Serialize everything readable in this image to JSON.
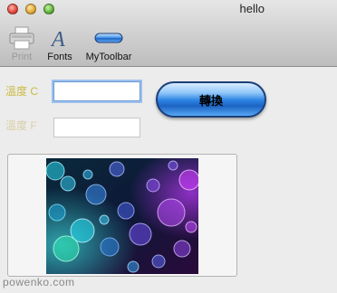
{
  "window": {
    "title": "hello"
  },
  "toolbar": {
    "items": [
      {
        "label": "Print",
        "icon": "printer-icon",
        "enabled": false
      },
      {
        "label": "Fonts",
        "icon": "fonts-icon",
        "enabled": true
      },
      {
        "label": "MyToolbar",
        "icon": "pill-icon",
        "enabled": true
      }
    ]
  },
  "form": {
    "celsius_label": "溫度 C",
    "fahrenheit_label": "溫度 F",
    "celsius_value": "",
    "fahrenheit_value": "",
    "convert_label": "轉換"
  },
  "image": {
    "icon": "bokeh-lights-image"
  },
  "footer": {
    "watermark": "powenko.com"
  },
  "colors": {
    "celsius_label": "#c9bb43",
    "fahrenheit_label": "#d8cfa6",
    "button_blue": "#2c84e3"
  }
}
